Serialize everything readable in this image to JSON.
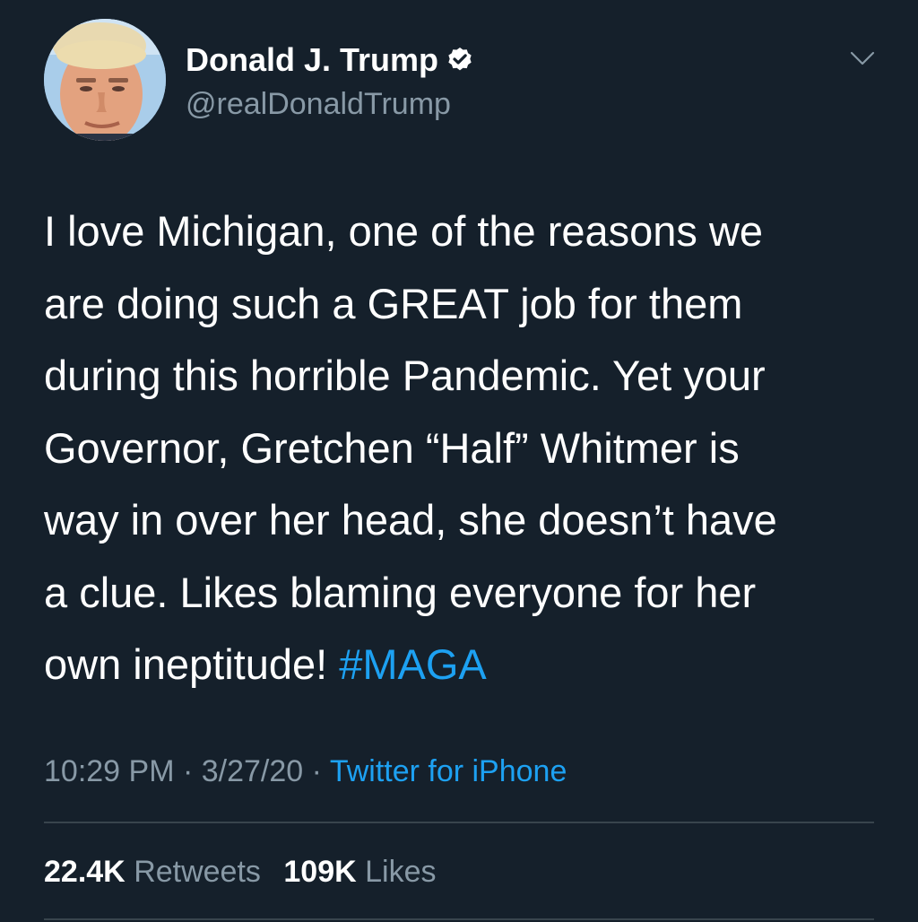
{
  "author": {
    "display_name": "Donald J. Trump",
    "handle": "@realDonaldTrump",
    "verified": true
  },
  "icons": {
    "verified": "verified-badge-icon",
    "menu": "chevron-down-icon"
  },
  "tweet": {
    "lines": [
      "I love Michigan, one of the reasons we",
      "are doing such a GREAT job for them",
      "during this horrible Pandemic. Yet your",
      "Governor, Gretchen “Half” Whitmer is",
      "way in over her head, she doesn’t have",
      "a clue. Likes blaming everyone for her",
      "own ineptitude! "
    ],
    "hashtag": "#MAGA"
  },
  "meta": {
    "time": "10:29 PM",
    "separator": " · ",
    "date": "3/27/20",
    "source": "Twitter for iPhone"
  },
  "stats": {
    "retweets_count": "22.4K",
    "retweets_label": "Retweets",
    "likes_count": "109K",
    "likes_label": "Likes"
  },
  "colors": {
    "background": "#15202b",
    "primary_text": "#ffffff",
    "secondary_text": "#8899a6",
    "accent": "#1da1f2",
    "divider": "#38444d"
  }
}
